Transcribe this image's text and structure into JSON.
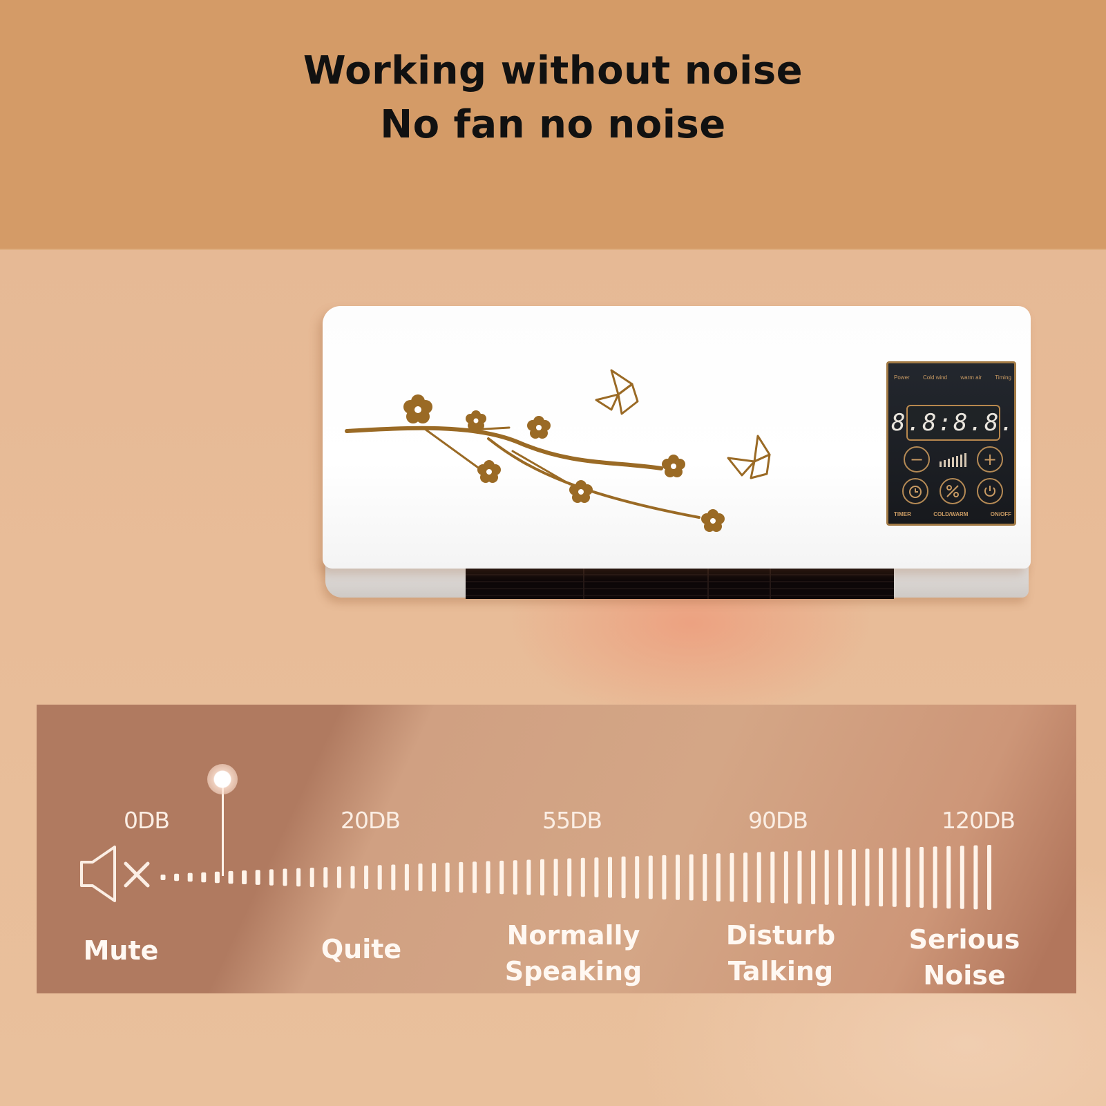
{
  "header": {
    "title_line1": "Working without noise",
    "title_line2": "No fan no noise",
    "background_color": "#d49b67"
  },
  "product": {
    "name": "wall-mounted heater",
    "decal_color": "#9a6a25",
    "control_panel": {
      "top_labels": [
        "Power",
        "Cold wind",
        "warm air",
        "Timing"
      ],
      "display": "8.8:8.8.",
      "buttons": [
        {
          "icon": "minus-icon",
          "label": "−"
        },
        {
          "icon": "plus-icon",
          "label": "+"
        },
        {
          "icon": "timer-icon",
          "label": "TIMER"
        },
        {
          "icon": "cold-warm-icon",
          "label": "COLD/WARM"
        },
        {
          "icon": "power-icon",
          "label": "ON/OFF"
        }
      ],
      "bottom_labels": [
        "TIMER",
        "COLD/WARM",
        "ON/OFF"
      ]
    }
  },
  "noise_scale": {
    "levels": [
      {
        "db": "0DB",
        "value": 0,
        "category": [
          "Mute"
        ]
      },
      {
        "db": "20DB",
        "value": 20,
        "category": [
          "Quite"
        ]
      },
      {
        "db": "55DB",
        "value": 55,
        "category": [
          "Normally",
          "Speaking"
        ]
      },
      {
        "db": "90DB",
        "value": 90,
        "category": [
          "Disturb",
          "Talking"
        ]
      },
      {
        "db": "120DB",
        "value": 120,
        "category": [
          "Serious",
          "Noise"
        ]
      }
    ],
    "marker_value_db": 5,
    "mute_icon": "speaker-muted-icon",
    "band_color": "#b07a60",
    "text_color": "#fbeee4"
  }
}
